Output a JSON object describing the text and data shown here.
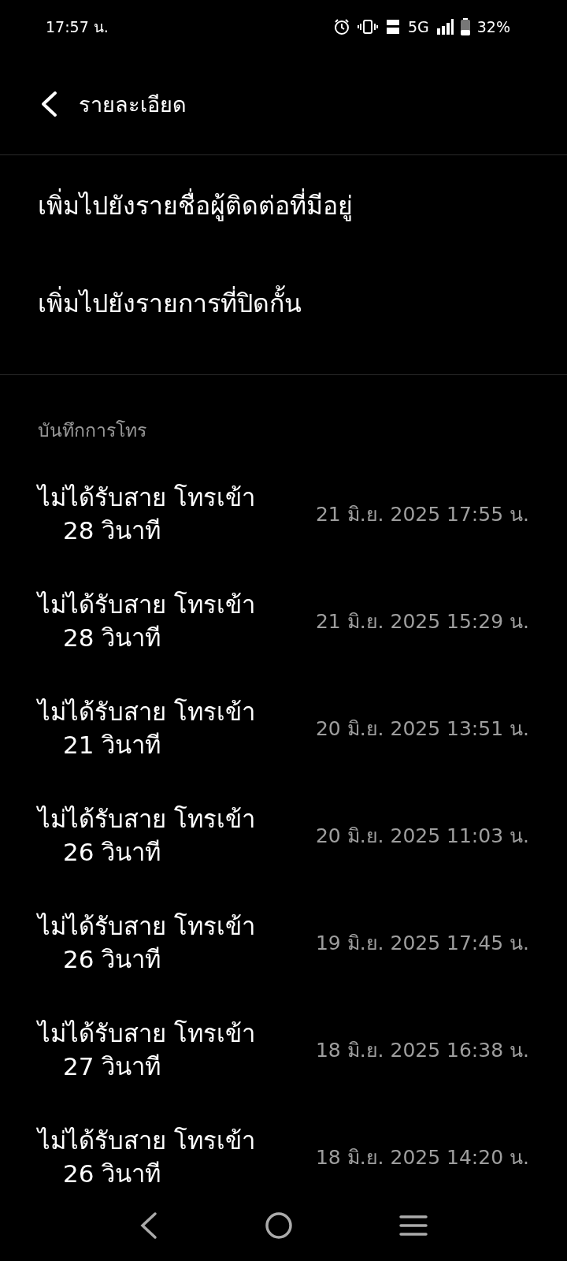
{
  "status_bar": {
    "time": "17:57 น.",
    "network": "5G",
    "battery": "32%"
  },
  "header": {
    "title": "รายละเอียด"
  },
  "actions": [
    "เพิ่มไปยังรายชื่อผู้ติดต่อที่มีอยู่",
    "เพิ่มไปยังรายการที่ปิดกั้น"
  ],
  "call_log": {
    "heading": "บันทึกการโทร",
    "entries": [
      {
        "status": "ไม่ได้รับสาย โทรเข้า",
        "duration": "28 วินาที",
        "date": "21 มิ.ย. 2025 17:55 น."
      },
      {
        "status": "ไม่ได้รับสาย โทรเข้า",
        "duration": "28 วินาที",
        "date": "21 มิ.ย. 2025 15:29 น."
      },
      {
        "status": "ไม่ได้รับสาย โทรเข้า",
        "duration": "21 วินาที",
        "date": "20 มิ.ย. 2025 13:51 น."
      },
      {
        "status": "ไม่ได้รับสาย โทรเข้า",
        "duration": "26 วินาที",
        "date": "20 มิ.ย. 2025 11:03 น."
      },
      {
        "status": "ไม่ได้รับสาย โทรเข้า",
        "duration": "26 วินาที",
        "date": "19 มิ.ย. 2025 17:45 น."
      },
      {
        "status": "ไม่ได้รับสาย โทรเข้า",
        "duration": "27 วินาที",
        "date": "18 มิ.ย. 2025 16:38 น."
      },
      {
        "status": "ไม่ได้รับสาย โทรเข้า",
        "duration": "26 วินาที",
        "date": "18 มิ.ย. 2025 14:20 น."
      }
    ]
  }
}
